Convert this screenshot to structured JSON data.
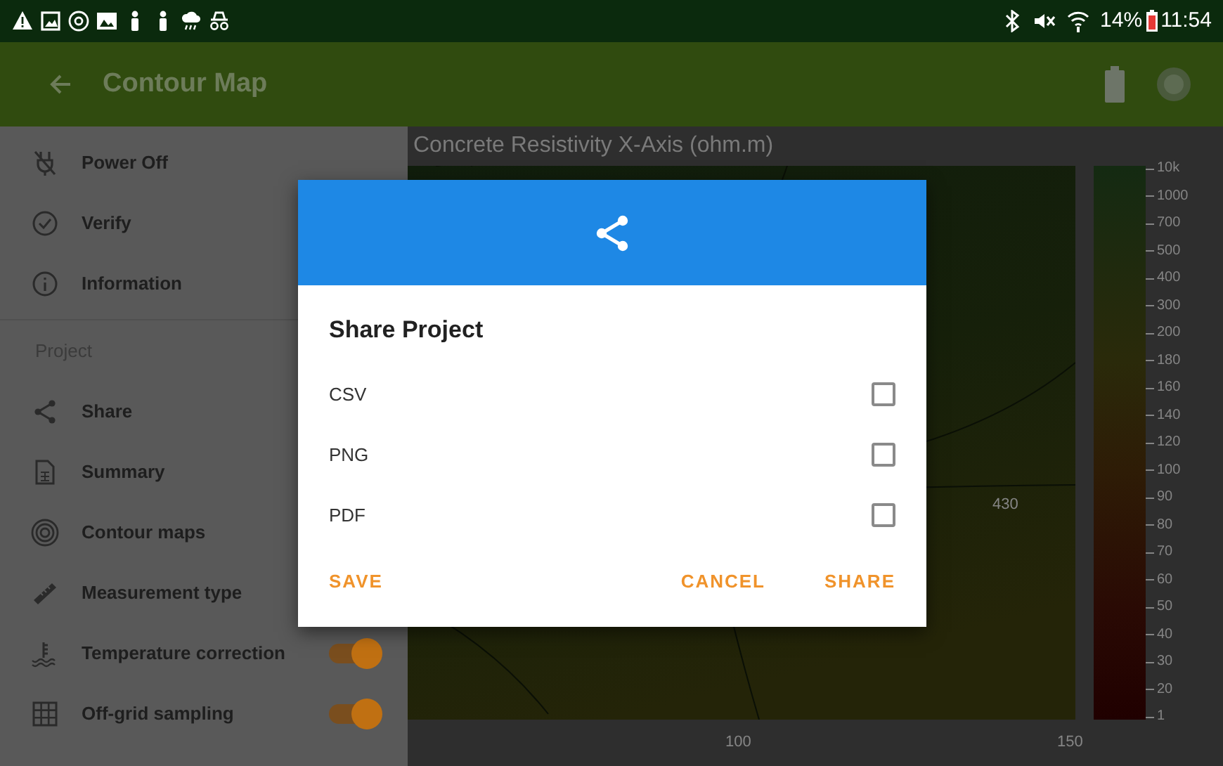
{
  "status_bar": {
    "battery_text": "14%",
    "time": "11:54"
  },
  "app_bar": {
    "title": "Contour Map"
  },
  "sidebar": {
    "items": [
      {
        "kind": "link",
        "label": "Power Off"
      },
      {
        "kind": "link",
        "label": "Verify"
      },
      {
        "kind": "link",
        "label": "Information"
      },
      {
        "kind": "header",
        "label": "Project"
      },
      {
        "kind": "link",
        "label": "Share"
      },
      {
        "kind": "link",
        "label": "Summary"
      },
      {
        "kind": "link",
        "label": "Contour maps"
      },
      {
        "kind": "link",
        "label": "Measurement type"
      },
      {
        "kind": "toggle",
        "label": "Temperature correction",
        "on": true
      },
      {
        "kind": "toggle",
        "label": "Off-grid sampling",
        "on": true
      }
    ]
  },
  "chart": {
    "title": "Concrete Resistivity X-Axis (ohm.m)",
    "x_tick_labels": [
      "100",
      "150"
    ],
    "contour_labels": [
      "430"
    ],
    "colorbar_labels": [
      "10k",
      "1000",
      "700",
      "500",
      "400",
      "300",
      "200",
      "180",
      "160",
      "140",
      "120",
      "100",
      "90",
      "80",
      "70",
      "60",
      "50",
      "40",
      "30",
      "20",
      "1"
    ]
  },
  "dialog": {
    "title": "Share Project",
    "options": [
      {
        "label": "CSV",
        "checked": false
      },
      {
        "label": "PNG",
        "checked": false
      },
      {
        "label": "PDF",
        "checked": false
      }
    ],
    "buttons": [
      {
        "label": "SAVE",
        "kind": "left"
      },
      {
        "label": "CANCEL",
        "kind": "right"
      },
      {
        "label": "SHARE",
        "kind": "right"
      }
    ]
  }
}
